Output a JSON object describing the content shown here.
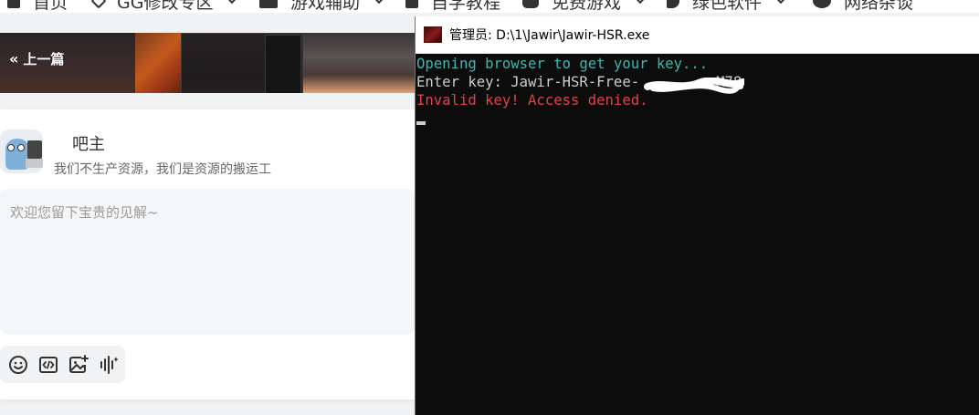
{
  "nav": {
    "items": [
      {
        "label": "首页",
        "icon": "home-icon",
        "has_dropdown": false
      },
      {
        "label": "GG修改专区",
        "icon": "diamond-icon",
        "has_dropdown": true
      },
      {
        "label": "游戏辅助",
        "icon": "gamepad-icon",
        "has_dropdown": true
      },
      {
        "label": "自学教程",
        "icon": "edit-icon",
        "has_dropdown": false
      },
      {
        "label": "免费游戏",
        "icon": "controller-icon",
        "has_dropdown": true
      },
      {
        "label": "绿色软件",
        "icon": "app-icon",
        "has_dropdown": true
      },
      {
        "label": "网络杂谈",
        "icon": "chat-bubble-icon",
        "has_dropdown": false
      }
    ]
  },
  "banner": {
    "prev_label": "上一篇",
    "prev_icon": "double-chevron-left-icon"
  },
  "comment": {
    "user_name": "吧主",
    "user_bio": "我们不生产资源，我们是资源的搬运工",
    "placeholder": "欢迎您留下宝贵的见解~",
    "toolbar": [
      "emoji-icon",
      "code-icon",
      "image-icon",
      "voice-icon"
    ]
  },
  "console": {
    "title": "管理员: D:\\1\\Jawir\\Jawir-HSR.exe",
    "lines": [
      {
        "text": "Opening browser to get your key...",
        "color": "#3ab8b0"
      },
      {
        "text": "Enter key: Jawir-HSR-Free-",
        "color": "#cccccc"
      },
      {
        "text": "Invalid key! Access denied.",
        "color": "#e04148"
      }
    ],
    "key_suffix": "M78"
  }
}
